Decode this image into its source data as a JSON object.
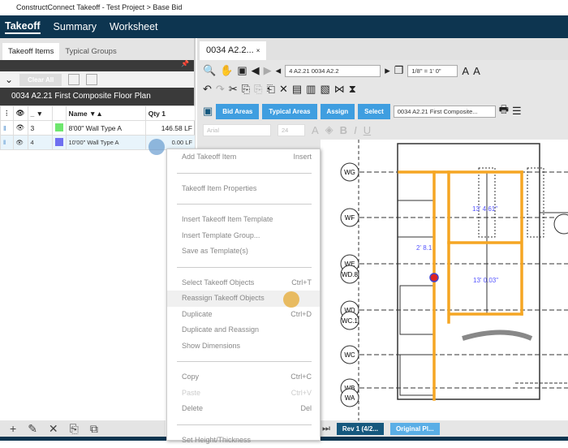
{
  "window": {
    "title": "ConstructConnect Takeoff - Test Project > Base Bid"
  },
  "nav": {
    "tabs": [
      "Takeoff",
      "Summary",
      "Worksheet"
    ]
  },
  "left": {
    "tabs": [
      "Takeoff Items",
      "Typical Groups"
    ],
    "clear_all": "Clear All",
    "plan_title": "0034 A2.21 First Composite Floor Plan",
    "columns": [
      "_",
      "Name",
      "Qty 1"
    ],
    "rows": [
      {
        "num": "3",
        "name": "8'00\" Wall Type A",
        "qty": "146.58 LF",
        "color": "#6ee66e"
      },
      {
        "num": "4",
        "name": "10'00\" Wall Type A",
        "qty": "0.00 LF",
        "color": "#6f6ff0"
      }
    ]
  },
  "right": {
    "tab": "0034 A2.2...",
    "page_select": "4  A2.21 0034 A2.2",
    "scale": "1/8\" = 1' 0\"",
    "buttons": [
      "Bid Areas",
      "Typical Areas",
      "Assign",
      "Select"
    ],
    "area_select": "0034 A2.21 First Composite...",
    "font": "Arial",
    "font_size": "24",
    "dims": [
      "13' 4.61\"",
      "2' 8.1",
      "13' 0.03\""
    ],
    "grid": [
      "WG",
      "WF",
      "WE",
      "WD.8",
      "WD",
      "WC.1",
      "WC",
      "WB",
      "WA"
    ],
    "rev": "Rev 1 (4/2...",
    "original": "Original Pl...",
    "accent": "#f5a623"
  },
  "menu": [
    {
      "label": "Add Takeoff Item",
      "key": "Insert"
    },
    {
      "sep": true
    },
    {
      "label": "Takeoff Item Properties",
      "key": ""
    },
    {
      "sep": true
    },
    {
      "label": "Insert Takeoff Item Template",
      "key": ""
    },
    {
      "label": "Insert Template Group...",
      "key": ""
    },
    {
      "label": "Save as Template(s)",
      "key": ""
    },
    {
      "sep": true
    },
    {
      "label": "Select Takeoff Objects",
      "key": "Ctrl+T"
    },
    {
      "label": "Reassign Takeoff Objects",
      "key": "",
      "hl": true
    },
    {
      "label": "Duplicate",
      "key": "Ctrl+D"
    },
    {
      "label": "Duplicate and Reassign",
      "key": ""
    },
    {
      "label": "Show Dimensions",
      "key": ""
    },
    {
      "sep": true
    },
    {
      "label": "Copy",
      "key": "Ctrl+C"
    },
    {
      "label": "Paste",
      "key": "Ctrl+V",
      "dis": true
    },
    {
      "label": "Delete",
      "key": "Del"
    },
    {
      "sep": true
    },
    {
      "label": "Set Height/Thickness",
      "key": ""
    }
  ]
}
